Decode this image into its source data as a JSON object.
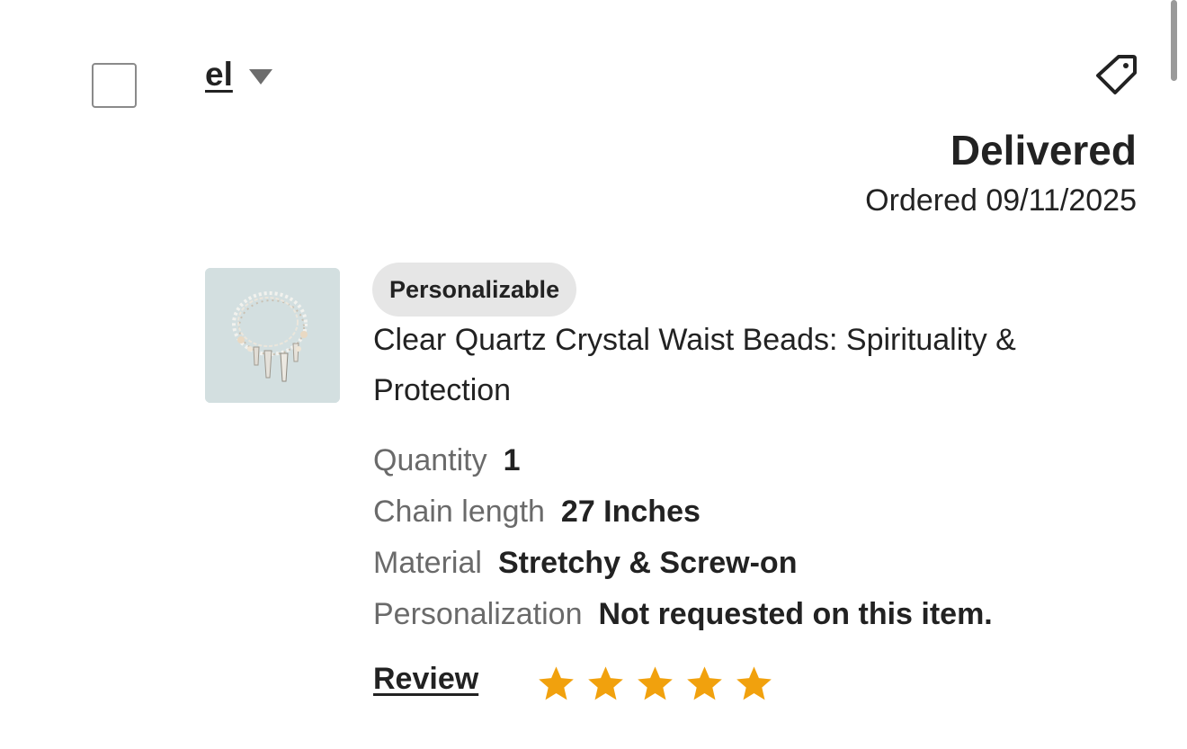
{
  "shop": {
    "name": "el"
  },
  "order": {
    "status": "Delivered",
    "ordered_text": "Ordered 09/11/2025"
  },
  "item": {
    "badge": "Personalizable",
    "title": "Clear Quartz Crystal Waist Beads: Spirituality & Protection",
    "attributes": [
      {
        "label": "Quantity",
        "value": "1"
      },
      {
        "label": "Chain length",
        "value": "27 Inches"
      },
      {
        "label": "Material",
        "value": "Stretchy & Screw-on"
      },
      {
        "label": "Personalization",
        "value": "Not requested on this item."
      }
    ]
  },
  "review": {
    "link_label": "Review",
    "rating": 5,
    "max_rating": 5,
    "star_color": "#f1a10d"
  },
  "icons": {
    "checkbox": "checkbox-icon",
    "dropdown": "caret-down-icon",
    "tag": "tag-icon",
    "star": "star-icon"
  }
}
